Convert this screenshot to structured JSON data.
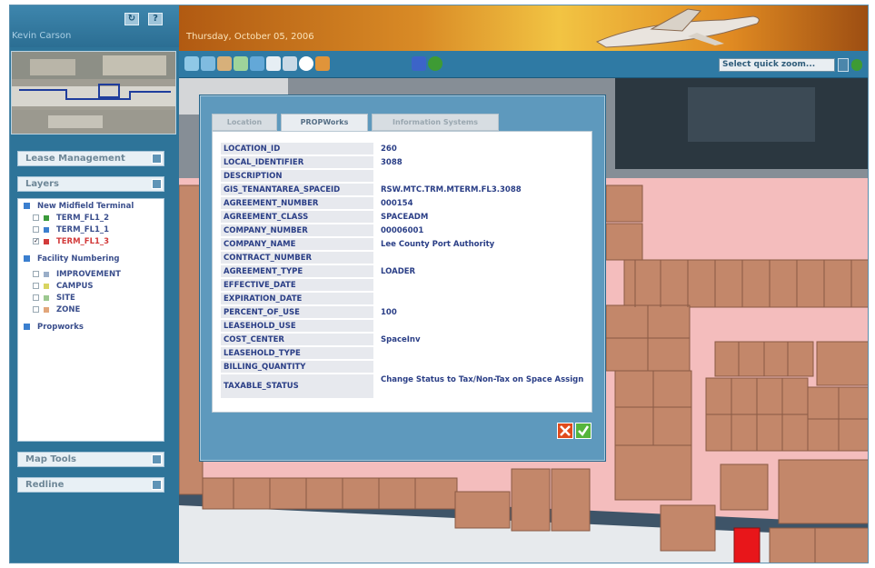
{
  "user": {
    "name": "Kevin Carson"
  },
  "header": {
    "date": "Thursday, October 05, 2006"
  },
  "top_buttons": [
    {
      "icon": "refresh-icon"
    },
    {
      "icon": "help-icon",
      "label": "?"
    }
  ],
  "sidebar": {
    "lease_management": "Lease Management",
    "layers": {
      "title": "Layers",
      "groups": [
        {
          "label": "New Midfield Terminal",
          "icon_color": "#3b7fcf",
          "children": [
            {
              "label": "TERM_FL1_2",
              "checked": false,
              "color": "#3a9a3a"
            },
            {
              "label": "TERM_FL1_1",
              "checked": false,
              "color": "#3b7fcf"
            },
            {
              "label": "TERM_FL1_3",
              "checked": true,
              "color": "#d23a3a"
            }
          ]
        },
        {
          "label": "Facility Numbering",
          "icon_color": "#3b7fcf",
          "children": [
            {
              "label": "IMPROVEMENT",
              "checked": false,
              "color": "#9aaec8"
            },
            {
              "label": "CAMPUS",
              "checked": false,
              "color": "#d8d460"
            },
            {
              "label": "SITE",
              "checked": false,
              "color": "#9cc890"
            },
            {
              "label": "ZONE",
              "checked": false,
              "color": "#e2a67a"
            }
          ]
        },
        {
          "label": "Propworks",
          "icon_color": "#3b7fcf",
          "children": []
        }
      ]
    },
    "map_tools": "Map Tools",
    "redline": "Redline"
  },
  "toolbar": {
    "tools": [
      "zoom-in-icon",
      "zoom-out-icon",
      "pan-icon",
      "measure-icon",
      "identify-icon",
      "select-icon",
      "clear-icon",
      "info-icon",
      "print-icon",
      "save-icon",
      "globe-icon"
    ],
    "quick_zoom_placeholder": "Select quick zoom..."
  },
  "dialog": {
    "tabs": [
      "Location",
      "PROPWorks",
      "Information Systems"
    ],
    "active_tab": "PROPWorks",
    "fields": [
      {
        "key": "LOCATION_ID",
        "value": "260"
      },
      {
        "key": "LOCAL_IDENTIFIER",
        "value": "3088"
      },
      {
        "key": "DESCRIPTION",
        "value": ""
      },
      {
        "key": "GIS_TENANTAREA_SPACEID",
        "value": "RSW.MTC.TRM.MTERM.FL3.3088"
      },
      {
        "key": "AGREEMENT_NUMBER",
        "value": "000154"
      },
      {
        "key": "AGREEMENT_CLASS",
        "value": "SPACEADM"
      },
      {
        "key": "COMPANY_NUMBER",
        "value": "00006001"
      },
      {
        "key": "COMPANY_NAME",
        "value": "Lee County Port Authority"
      },
      {
        "key": "CONTRACT_NUMBER",
        "value": ""
      },
      {
        "key": "AGREEMENT_TYPE",
        "value": "LOADER"
      },
      {
        "key": "EFFECTIVE_DATE",
        "value": ""
      },
      {
        "key": "EXPIRATION_DATE",
        "value": ""
      },
      {
        "key": "PERCENT_OF_USE",
        "value": "100"
      },
      {
        "key": "LEASEHOLD_USE",
        "value": ""
      },
      {
        "key": "COST_CENTER",
        "value": "SpaceInv"
      },
      {
        "key": "LEASEHOLD_TYPE",
        "value": ""
      },
      {
        "key": "BILLING_QUANTITY",
        "value": ""
      },
      {
        "key": "TAXABLE_STATUS",
        "value": "Change Status to Tax/Non-Tax on Space Assign"
      }
    ]
  },
  "colors": {
    "frame": "#2e7499",
    "dialog": "#5e99bd",
    "space_fill": "#c3876a",
    "selected_space": "#e8161a",
    "corridor": "#f4bdbd"
  }
}
